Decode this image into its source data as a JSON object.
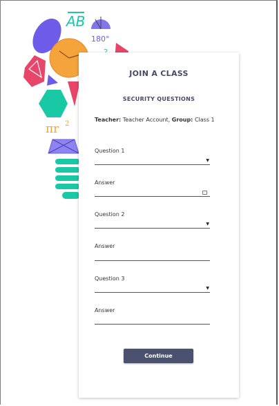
{
  "card": {
    "title": "JOIN A CLASS",
    "subtitle": "SECURITY QUESTIONS"
  },
  "info": {
    "teacher_label": "Teacher:",
    "teacher_value": "Teacher Account,",
    "group_label": "Group:",
    "group_value": "Class 1"
  },
  "fields": {
    "question1_label": "Question 1",
    "answer1_label": "Answer",
    "question2_label": "Question 2",
    "answer2_label": "Answer",
    "question3_label": "Question 3",
    "answer3_label": "Answer"
  },
  "actions": {
    "continue_label": "Continue"
  },
  "decor": {
    "ab_text": "AB",
    "angle_text": "180°",
    "sup_text": "2",
    "pi_text": "πr",
    "pi_sup": "2"
  },
  "colors": {
    "primary": "#4a5270",
    "title": "#444a63",
    "purple": "#6c5ce7",
    "orange": "#f5a33b",
    "teal": "#19c9a6",
    "pink": "#e8456b"
  }
}
